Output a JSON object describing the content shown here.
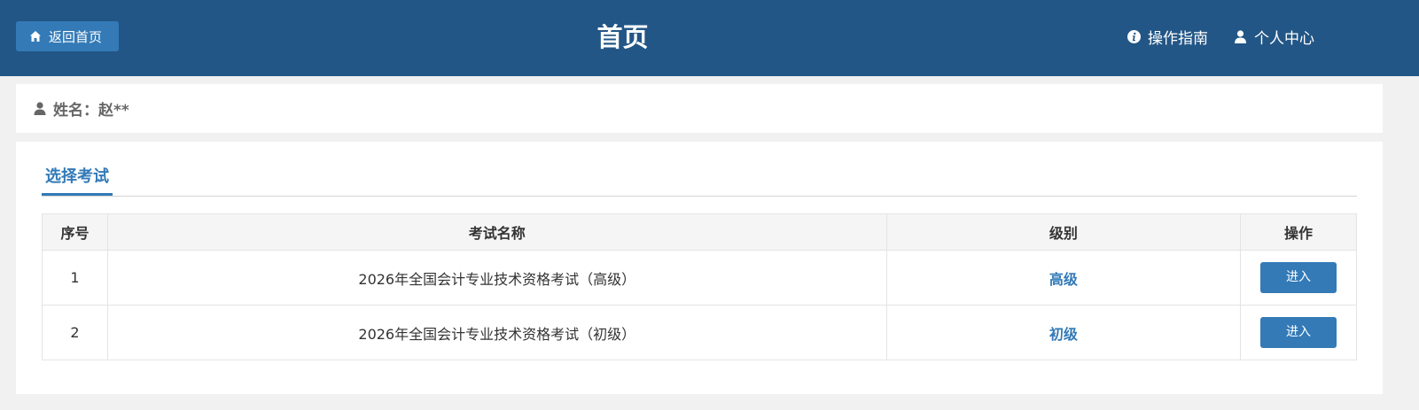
{
  "header": {
    "home_button_label": "返回首页",
    "title": "首页",
    "guide_label": "操作指南",
    "user_center_label": "个人中心"
  },
  "user": {
    "name_label": "姓名：赵**"
  },
  "tabs": [
    {
      "label": "选择考试",
      "active": true
    }
  ],
  "table": {
    "columns": [
      "序号",
      "考试名称",
      "级别",
      "操作"
    ],
    "rows": [
      {
        "index": "1",
        "name": "2026年全国会计专业技术资格考试（高级）",
        "level": "高级",
        "action": "进入"
      },
      {
        "index": "2",
        "name": "2026年全国会计专业技术资格考试（初级）",
        "level": "初级",
        "action": "进入"
      }
    ]
  },
  "colors": {
    "header_bg": "#225686",
    "primary": "#337ab7",
    "page_bg": "#f1f1f1"
  },
  "icons": {
    "home": "home-icon",
    "info": "info-icon",
    "user": "user-icon"
  }
}
